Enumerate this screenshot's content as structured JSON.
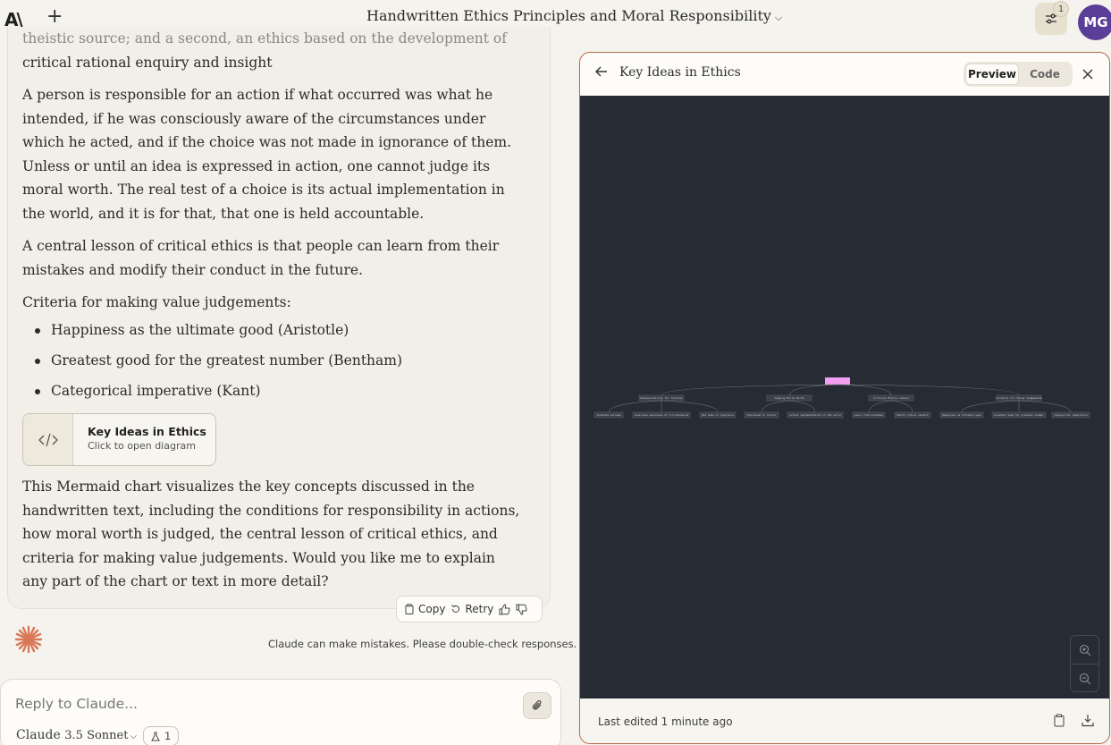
{
  "header": {
    "logo": "A\\",
    "new_chat": "+",
    "title": "Handwritten Ethics Principles and Moral Responsibility",
    "settings_badge": "1",
    "avatar_initials": "MG"
  },
  "chat": {
    "faded_lines": [
      "theistic source; and a second, an ethics based on the development of",
      "critical rational enquiry and insight"
    ],
    "para_responsibility": "A person is responsible for an action if what occurred was what he intended, if he was consciously aware of the circumstances under which he acted, and if the choice was not made in ignorance of them. Unless or until an idea is expressed in action, one cannot judge its moral worth. The real test of a choice is its actual implementation in the world, and it is for that, that one is held accountable.",
    "para_lesson": "A central lesson of critical ethics is that people can learn from their mistakes and modify their conduct in the future.",
    "criteria_heading": "Criteria for making value judgements:",
    "criteria": [
      "Happiness as the ultimate good (Aristotle)",
      "Greatest good for the greatest number (Bentham)",
      "Categorical imperative (Kant)"
    ],
    "artifact_card": {
      "name": "Key Ideas in Ethics",
      "subtitle": "Click to open diagram"
    },
    "para_summary": "This Mermaid chart visualizes the key concepts discussed in the handwritten text, including the conditions for responsibility in actions, how moral worth is judged, the central lesson of critical ethics, and criteria for making value judgements. Would you like me to explain any part of the chart or text in more detail?",
    "actions": {
      "copy": "Copy",
      "retry": "Retry"
    },
    "disclaimer": "Claude can make mistakes. Please double-check responses."
  },
  "reply": {
    "placeholder": "Reply to Claude...",
    "model_name": "Claude",
    "model_version": "3.5 Sonnet",
    "chip_count": "1"
  },
  "panel": {
    "title": "Key Ideas in Ethics",
    "tabs": [
      "Preview",
      "Code"
    ],
    "active_tab": "Preview",
    "footer": "Last edited 1 minute ago",
    "canvas_bg": "#272b33",
    "root_color": "#f39ff0"
  },
  "diagram": {
    "branches": [
      {
        "label": "Responsibility for Actions",
        "children": [
          "Intended outcome",
          "Conscious awareness of circumstances",
          "Not made in ignorance"
        ]
      },
      {
        "label": "Judging Moral Worth",
        "children": [
          "Expressed in action",
          "Actual implementation in the world"
        ]
      },
      {
        "label": "Critical Ethics Lesson",
        "children": [
          "Learn from mistakes",
          "Modify future conduct"
        ]
      },
      {
        "label": "Criteria for Value Judgements",
        "children": [
          "Happiness as ultimate good",
          "Greatest good for greatest number",
          "Categorical imperative"
        ]
      }
    ]
  }
}
